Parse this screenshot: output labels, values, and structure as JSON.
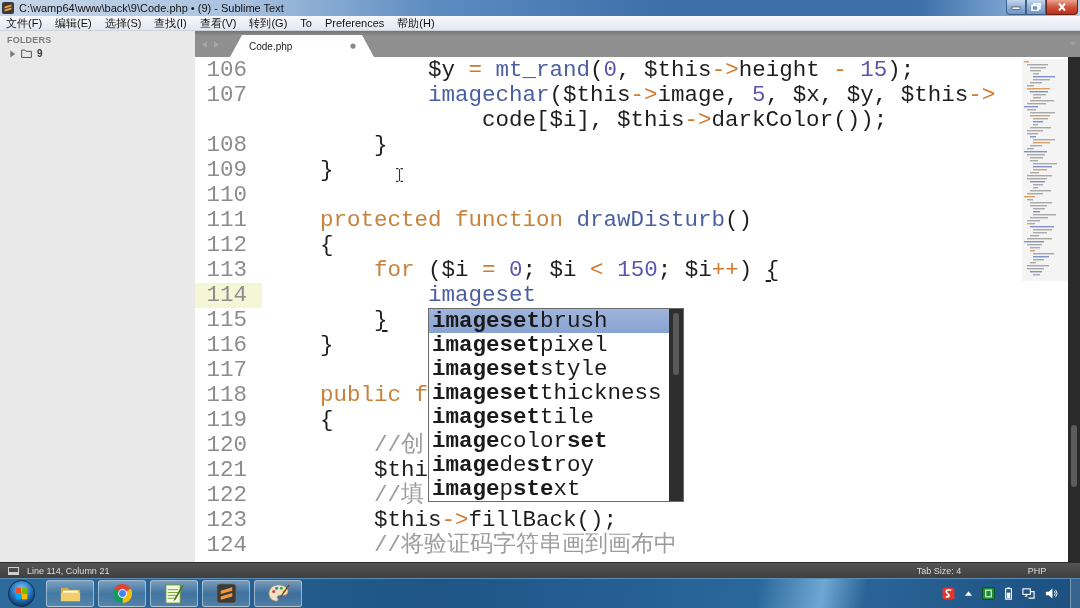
{
  "window": {
    "title": "C:\\wamp64\\www\\back\\9\\Code.php • (9) - Sublime Text"
  },
  "menu": [
    "文件(F)",
    "编辑(E)",
    "选择(S)",
    "查找(I)",
    "查看(V)",
    "转到(G)",
    "To",
    "Preferences",
    "帮助(H)"
  ],
  "sidebar": {
    "heading": "FOLDERS",
    "items": [
      {
        "label": "9",
        "expanded": false
      }
    ]
  },
  "tabs": [
    {
      "label": "Code.php",
      "selected": true,
      "modified": true
    }
  ],
  "editor": {
    "lines": [
      {
        "number": "106",
        "current": false,
        "tokens": [
          {
            "kind": "plain",
            "text": "            $y "
          },
          {
            "kind": "operator",
            "text": "= "
          },
          {
            "kind": "function",
            "text": "mt_rand"
          },
          {
            "kind": "plain",
            "text": "("
          },
          {
            "kind": "number",
            "text": "0"
          },
          {
            "kind": "plain",
            "text": ", $this"
          },
          {
            "kind": "operator",
            "text": "->"
          },
          {
            "kind": "plain",
            "text": "height "
          },
          {
            "kind": "operator",
            "text": "- "
          },
          {
            "kind": "number",
            "text": "15"
          },
          {
            "kind": "plain",
            "text": ");"
          }
        ]
      },
      {
        "number": "107",
        "current": false,
        "tokens": [
          {
            "kind": "function",
            "text": "            imagechar"
          },
          {
            "kind": "plain",
            "text": "($this"
          },
          {
            "kind": "operator",
            "text": "->"
          },
          {
            "kind": "plain",
            "text": "image, "
          },
          {
            "kind": "number",
            "text": "5"
          },
          {
            "kind": "plain",
            "text": ", $x, $y, $this"
          },
          {
            "kind": "operator",
            "text": "->"
          }
        ],
        "continuation": [
          {
            "kind": "plain",
            "text": "                code[$i], $this"
          },
          {
            "kind": "operator",
            "text": "->"
          },
          {
            "kind": "plain",
            "text": "darkColor());"
          }
        ]
      },
      {
        "number": "108",
        "current": false,
        "tokens": [
          {
            "kind": "plain",
            "text": "        }"
          }
        ]
      },
      {
        "number": "109",
        "current": false,
        "tokens": [
          {
            "kind": "plain",
            "text": "    }"
          }
        ]
      },
      {
        "number": "110",
        "current": false
      },
      {
        "number": "111",
        "current": false,
        "tokens": [
          {
            "kind": "keyword",
            "text": "    protected "
          },
          {
            "kind": "keyword",
            "text": "function "
          },
          {
            "kind": "function",
            "text": "drawDisturb"
          },
          {
            "kind": "plain",
            "text": "()"
          }
        ]
      },
      {
        "number": "112",
        "current": false,
        "tokens": [
          {
            "kind": "plain",
            "text": "    {"
          }
        ]
      },
      {
        "number": "113",
        "current": false,
        "tokens": [
          {
            "kind": "keyword",
            "text": "        for "
          },
          {
            "kind": "plain",
            "text": "($i "
          },
          {
            "kind": "operator",
            "text": "= "
          },
          {
            "kind": "number",
            "text": "0"
          },
          {
            "kind": "plain",
            "text": "; $i "
          },
          {
            "kind": "operator",
            "text": "< "
          },
          {
            "kind": "number",
            "text": "150"
          },
          {
            "kind": "plain",
            "text": "; $i"
          },
          {
            "kind": "operator",
            "text": "++"
          },
          {
            "kind": "plain",
            "text": ") "
          },
          {
            "kind": "bracket-match",
            "text": "{"
          }
        ]
      },
      {
        "number": "114",
        "current": true,
        "tokens": [
          {
            "kind": "function",
            "text": "            imageset"
          }
        ]
      },
      {
        "number": "115",
        "current": false,
        "tokens": [
          {
            "kind": "bracket-match",
            "text": "        }"
          }
        ]
      },
      {
        "number": "116",
        "current": false,
        "tokens": [
          {
            "kind": "plain",
            "text": "    }"
          }
        ]
      },
      {
        "number": "117",
        "current": false
      },
      {
        "number": "118",
        "current": false,
        "tokens": [
          {
            "kind": "keyword",
            "text": "    public "
          },
          {
            "kind": "keyword",
            "text": "f"
          }
        ]
      },
      {
        "number": "119",
        "current": false,
        "tokens": [
          {
            "kind": "plain",
            "text": "    {"
          }
        ]
      },
      {
        "number": "120",
        "current": false,
        "tokens": [
          {
            "kind": "comment",
            "text": "        //创"
          }
        ]
      },
      {
        "number": "121",
        "current": false,
        "tokens": [
          {
            "kind": "plain",
            "text": "        $thi"
          }
        ]
      },
      {
        "number": "122",
        "current": false,
        "tokens": [
          {
            "kind": "comment",
            "text": "        //填"
          }
        ]
      },
      {
        "number": "123",
        "current": false,
        "tokens": [
          {
            "kind": "plain",
            "text": "        $this"
          },
          {
            "kind": "operator",
            "text": "->"
          },
          {
            "kind": "plain",
            "text": "fillBack();"
          }
        ]
      },
      {
        "number": "124",
        "current": false,
        "tokens": [
          {
            "kind": "comment",
            "text": "        //将验证码字符串画到画布中"
          }
        ]
      }
    ],
    "autocomplete": {
      "items": [
        {
          "label": "**imageset**brush",
          "selected": true
        },
        {
          "label": "**imageset**pixel",
          "selected": false
        },
        {
          "label": "**imageset**style",
          "selected": false
        },
        {
          "label": "**imageset**thickness",
          "selected": false
        },
        {
          "label": "**imageset**tile",
          "selected": false
        },
        {
          "label": "**image**color**set**",
          "selected": false
        },
        {
          "label": "**image**de**st**roy",
          "selected": false
        },
        {
          "label": "**image**p**ste**xt",
          "selected": false
        }
      ]
    }
  },
  "status_bar": {
    "position": "Line 114, Column 21",
    "tab_size": "Tab Size: 4",
    "syntax": "PHP"
  }
}
